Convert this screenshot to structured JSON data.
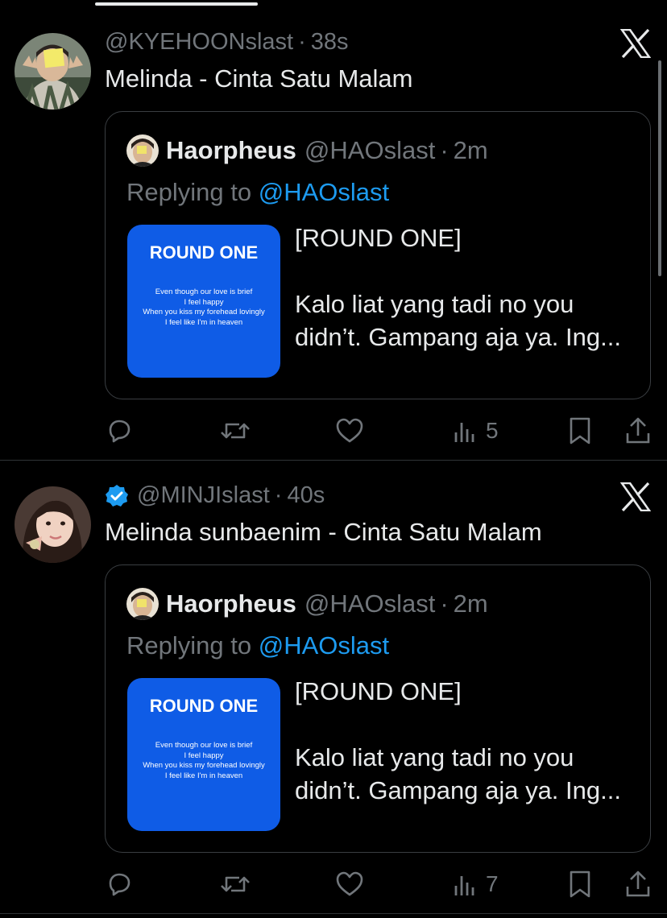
{
  "tweets": [
    {
      "handle": "@KYEHOONslast",
      "time": "38s",
      "verified": false,
      "text": "Melinda - Cinta Satu Malam",
      "quote": {
        "name": "Haorpheus",
        "handle": "@HAOslast",
        "time": "2m",
        "reply_prefix": "Replying to",
        "reply_to": "@HAOslast",
        "card_title": "ROUND ONE",
        "card_lyrics": [
          "Even though our love is brief",
          "I feel happy",
          "When you kiss my forehead lovingly",
          "I feel like I'm in heaven"
        ],
        "body_line1": "[ROUND ONE]",
        "body_line2": "Kalo liat yang tadi no you",
        "body_line3": "didn’t. Gampang aja ya. Ing..."
      },
      "views": "5"
    },
    {
      "handle": "@MINJIslast",
      "time": "40s",
      "verified": true,
      "text": "Melinda sunbaenim - Cinta Satu Malam",
      "quote": {
        "name": "Haorpheus",
        "handle": "@HAOslast",
        "time": "2m",
        "reply_prefix": "Replying to",
        "reply_to": "@HAOslast",
        "card_title": "ROUND ONE",
        "card_lyrics": [
          "Even though our love is brief",
          "I feel happy",
          "When you kiss my forehead lovingly",
          "I feel like I'm in heaven"
        ],
        "body_line1": "[ROUND ONE]",
        "body_line2": "Kalo liat yang tadi no you",
        "body_line3": "didn’t. Gampang aja ya. Ing..."
      },
      "views": "7"
    }
  ],
  "icons": {
    "reply": "reply-icon",
    "retweet": "retweet-icon",
    "like": "like-icon",
    "views": "views-icon",
    "bookmark": "bookmark-icon",
    "share": "share-icon",
    "brand": "x-logo-icon",
    "verified": "verified-badge-icon"
  },
  "colors": {
    "background": "#000000",
    "text": "#e7e9ea",
    "muted": "#71767b",
    "accent": "#1d9bf0",
    "card": "#0f5ce6"
  }
}
